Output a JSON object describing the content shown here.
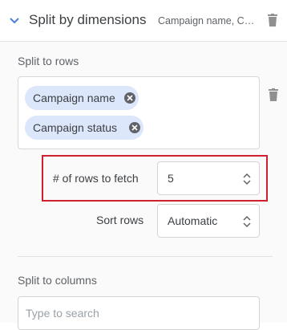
{
  "header": {
    "title": "Split by dimensions",
    "summary": "Campaign name, Ca...",
    "expand_icon": "chevron-down-icon",
    "delete_icon": "trash-icon"
  },
  "split_rows": {
    "label": "Split to rows",
    "chips": [
      {
        "label": "Campaign name",
        "remove_icon": "close-circle-icon"
      },
      {
        "label": "Campaign status",
        "remove_icon": "close-circle-icon"
      }
    ],
    "delete_icon": "trash-icon"
  },
  "rows_to_fetch": {
    "label": "# of rows to fetch",
    "value": "5"
  },
  "sort_rows": {
    "label": "Sort rows",
    "value": "Automatic"
  },
  "split_columns": {
    "label": "Split to columns",
    "search_placeholder": "Type to search"
  },
  "colors": {
    "chip_background": "#dde7fb",
    "highlight_border": "#d0202f",
    "accent": "#4a7fd4"
  }
}
